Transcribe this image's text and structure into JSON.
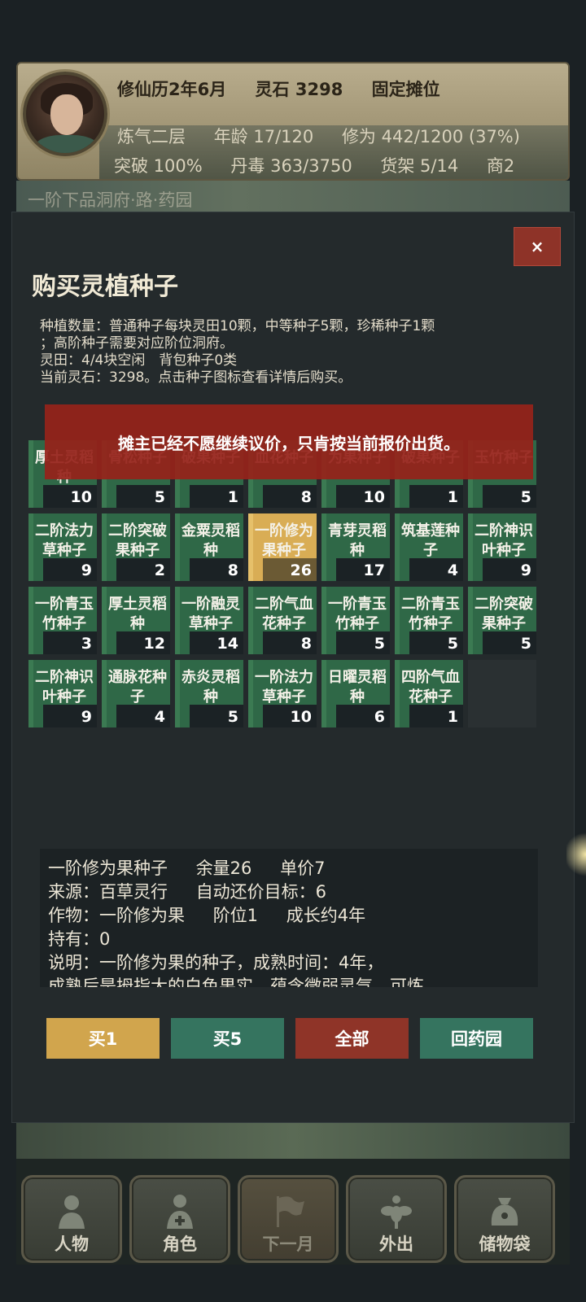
{
  "header": {
    "date": "修仙历2年6月",
    "spirit_stones": "灵石 3298",
    "stall": "固定摊位",
    "realm": "炼气二层",
    "age": "年龄 17/120",
    "cultivation": "修为 442/1200 (37%)",
    "breakthrough": "突破 100%",
    "pill_poison": "丹毒 363/3750",
    "shelf": "货架 5/14",
    "merchant": "商2",
    "scene_title": "一阶下品洞府·路·药园"
  },
  "modal": {
    "title": "购买灵植种子",
    "close_label": "×",
    "info_line1": "种植数量：普通种子每块灵田10颗，中等种子5颗，珍稀种子1颗",
    "info_line2": "；高阶种子需要对应阶位洞府。",
    "info_line3": "灵田：4/4块空闲　背包种子0类",
    "info_line4": "当前灵石：3298。点击种子图标查看详情后购买。",
    "toast": "摊主已经不愿继续议价，只肯按当前报价出货。"
  },
  "seeds": [
    {
      "name": "厚土灵稻种",
      "count": "10"
    },
    {
      "name": "骨松种子",
      "count": "5"
    },
    {
      "name": "破果种子",
      "count": "1"
    },
    {
      "name": "血花种子",
      "count": "8"
    },
    {
      "name": "为果种子",
      "count": "10"
    },
    {
      "name": "破果种子",
      "count": "1"
    },
    {
      "name": "玉竹种子",
      "count": "5"
    },
    {
      "name": "二阶法力草种子",
      "count": "9"
    },
    {
      "name": "二阶突破果种子",
      "count": "2"
    },
    {
      "name": "金粟灵稻种",
      "count": "8"
    },
    {
      "name": "一阶修为果种子",
      "count": "26"
    },
    {
      "name": "青芽灵稻种",
      "count": "17"
    },
    {
      "name": "筑基莲种子",
      "count": "4"
    },
    {
      "name": "二阶神识叶种子",
      "count": "9"
    },
    {
      "name": "一阶青玉竹种子",
      "count": "3"
    },
    {
      "name": "厚土灵稻种",
      "count": "12"
    },
    {
      "name": "一阶融灵草种子",
      "count": "14"
    },
    {
      "name": "二阶气血花种子",
      "count": "8"
    },
    {
      "name": "一阶青玉竹种子",
      "count": "5"
    },
    {
      "name": "二阶青玉竹种子",
      "count": "5"
    },
    {
      "name": "二阶突破果种子",
      "count": "5"
    },
    {
      "name": "二阶神识叶种子",
      "count": "9"
    },
    {
      "name": "通脉花种子",
      "count": "4"
    },
    {
      "name": "赤炎灵稻种",
      "count": "5"
    },
    {
      "name": "一阶法力草种子",
      "count": "10"
    },
    {
      "name": "日曜灵稻种",
      "count": "6"
    },
    {
      "name": "四阶气血花种子",
      "count": "1"
    }
  ],
  "detail": {
    "name": "一阶修为果种子",
    "stock": "余量26",
    "price": "单价7",
    "source": "来源：百草灵行",
    "auto_bargain": "自动还价目标：6",
    "crop": "作物：一阶修为果",
    "tier": "阶位1",
    "growth": "成长约4年",
    "held": "持有：0",
    "desc1": "说明：一阶修为果的种子，成熟时间：4年，",
    "desc2": "成熟后是拇指大的白色果实，蕴含微弱灵气，可炼"
  },
  "actions": {
    "buy1": "买1",
    "buy5": "买5",
    "all": "全部",
    "back": "回药园"
  },
  "nav": [
    {
      "label": "人物",
      "icon": "person-icon"
    },
    {
      "label": "角色",
      "icon": "character-icon"
    },
    {
      "label": "下一月",
      "icon": "flag-icon"
    },
    {
      "label": "外出",
      "icon": "flower-icon"
    },
    {
      "label": "储物袋",
      "icon": "bag-icon"
    }
  ]
}
